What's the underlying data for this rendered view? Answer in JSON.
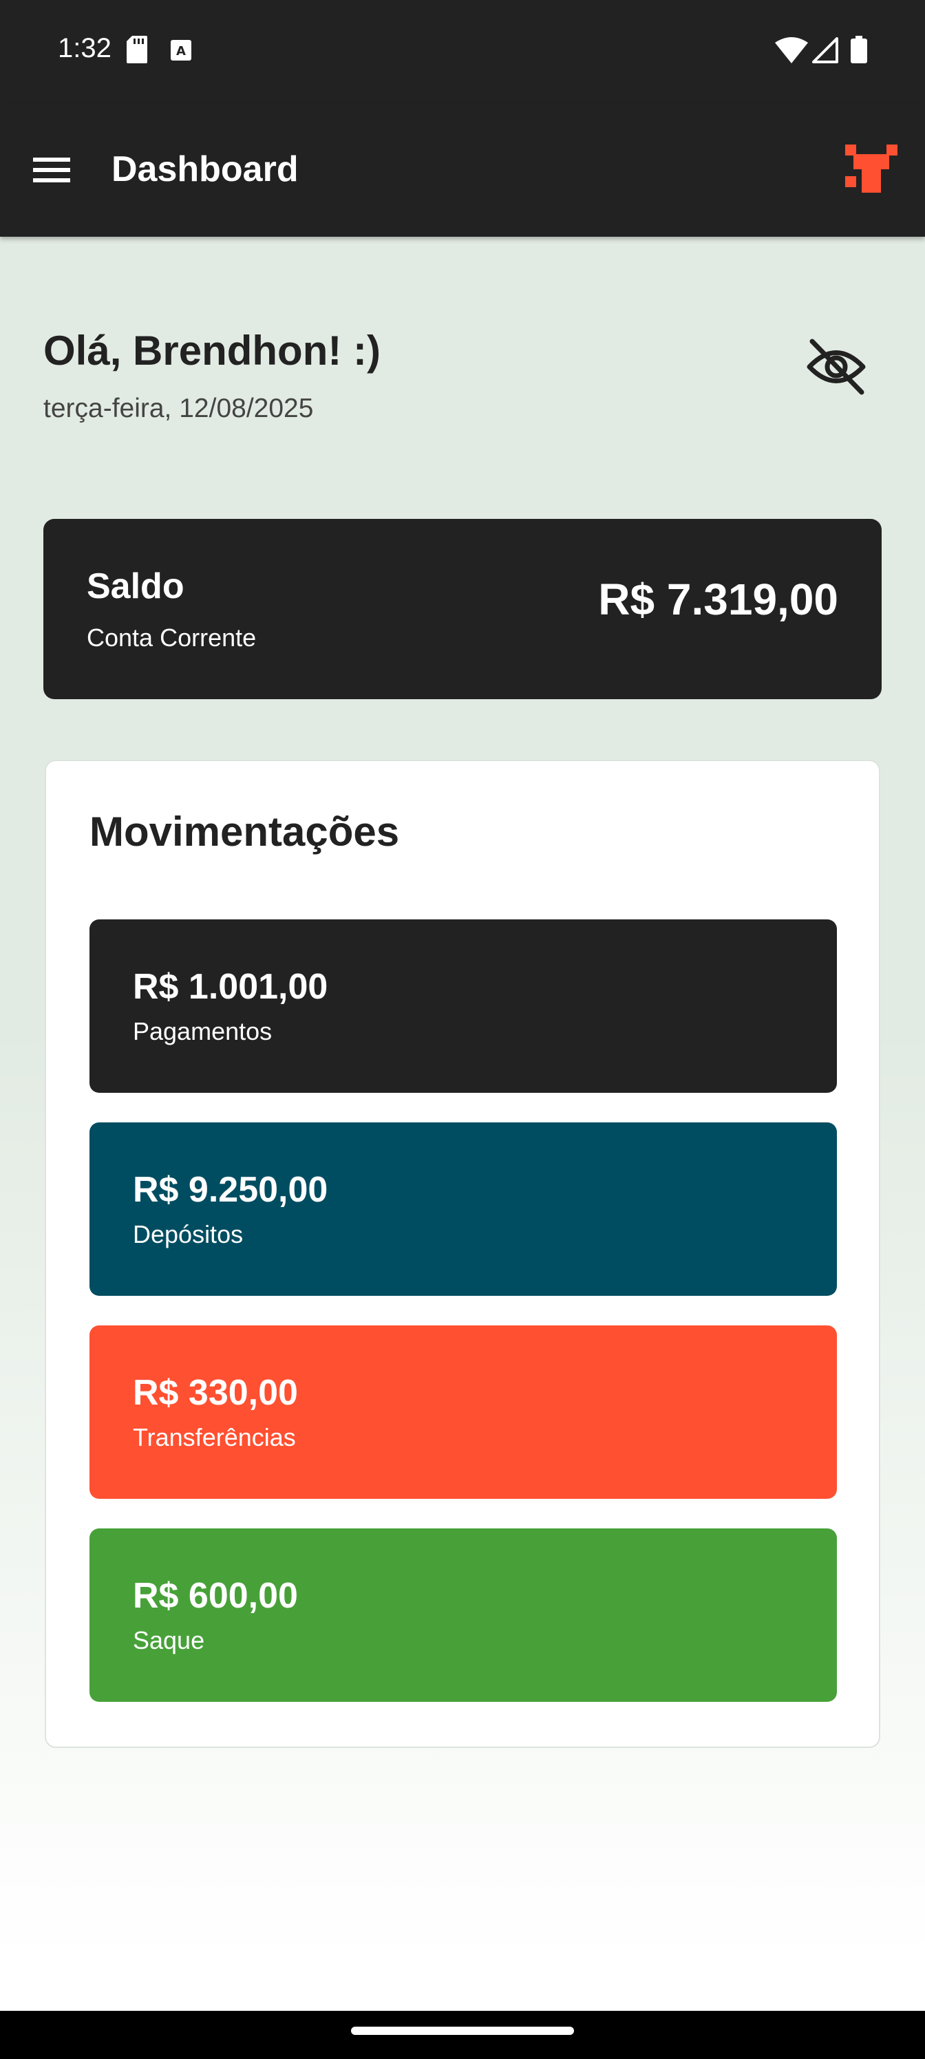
{
  "status_bar": {
    "time": "1:32",
    "icons": [
      "sd-card-icon",
      "keyboard-a-icon",
      "wifi-icon",
      "signal-icon",
      "battery-icon"
    ]
  },
  "app_bar": {
    "title": "Dashboard",
    "menu_icon": "hamburger-menu-icon",
    "logo": "brand-logo",
    "accent_color": "#FF5031",
    "background": "#222222"
  },
  "greeting": {
    "text": "Olá, Brendhon! :)",
    "date": "terça-feira, 12/08/2025",
    "visibility_icon": "eye-off-icon"
  },
  "balance": {
    "title": "Saldo",
    "account_type": "Conta Corrente",
    "value": "R$ 7.319,00"
  },
  "movements": {
    "title": "Movimentações",
    "items": [
      {
        "amount": "R$ 1.001,00",
        "label": "Pagamentos",
        "color": "#222222"
      },
      {
        "amount": "R$ 9.250,00",
        "label": "Depósitos",
        "color": "#004D61"
      },
      {
        "amount": "R$ 330,00",
        "label": "Transferências",
        "color": "#FF5031"
      },
      {
        "amount": "R$ 600,00",
        "label": "Saque",
        "color": "#47A138"
      }
    ]
  }
}
